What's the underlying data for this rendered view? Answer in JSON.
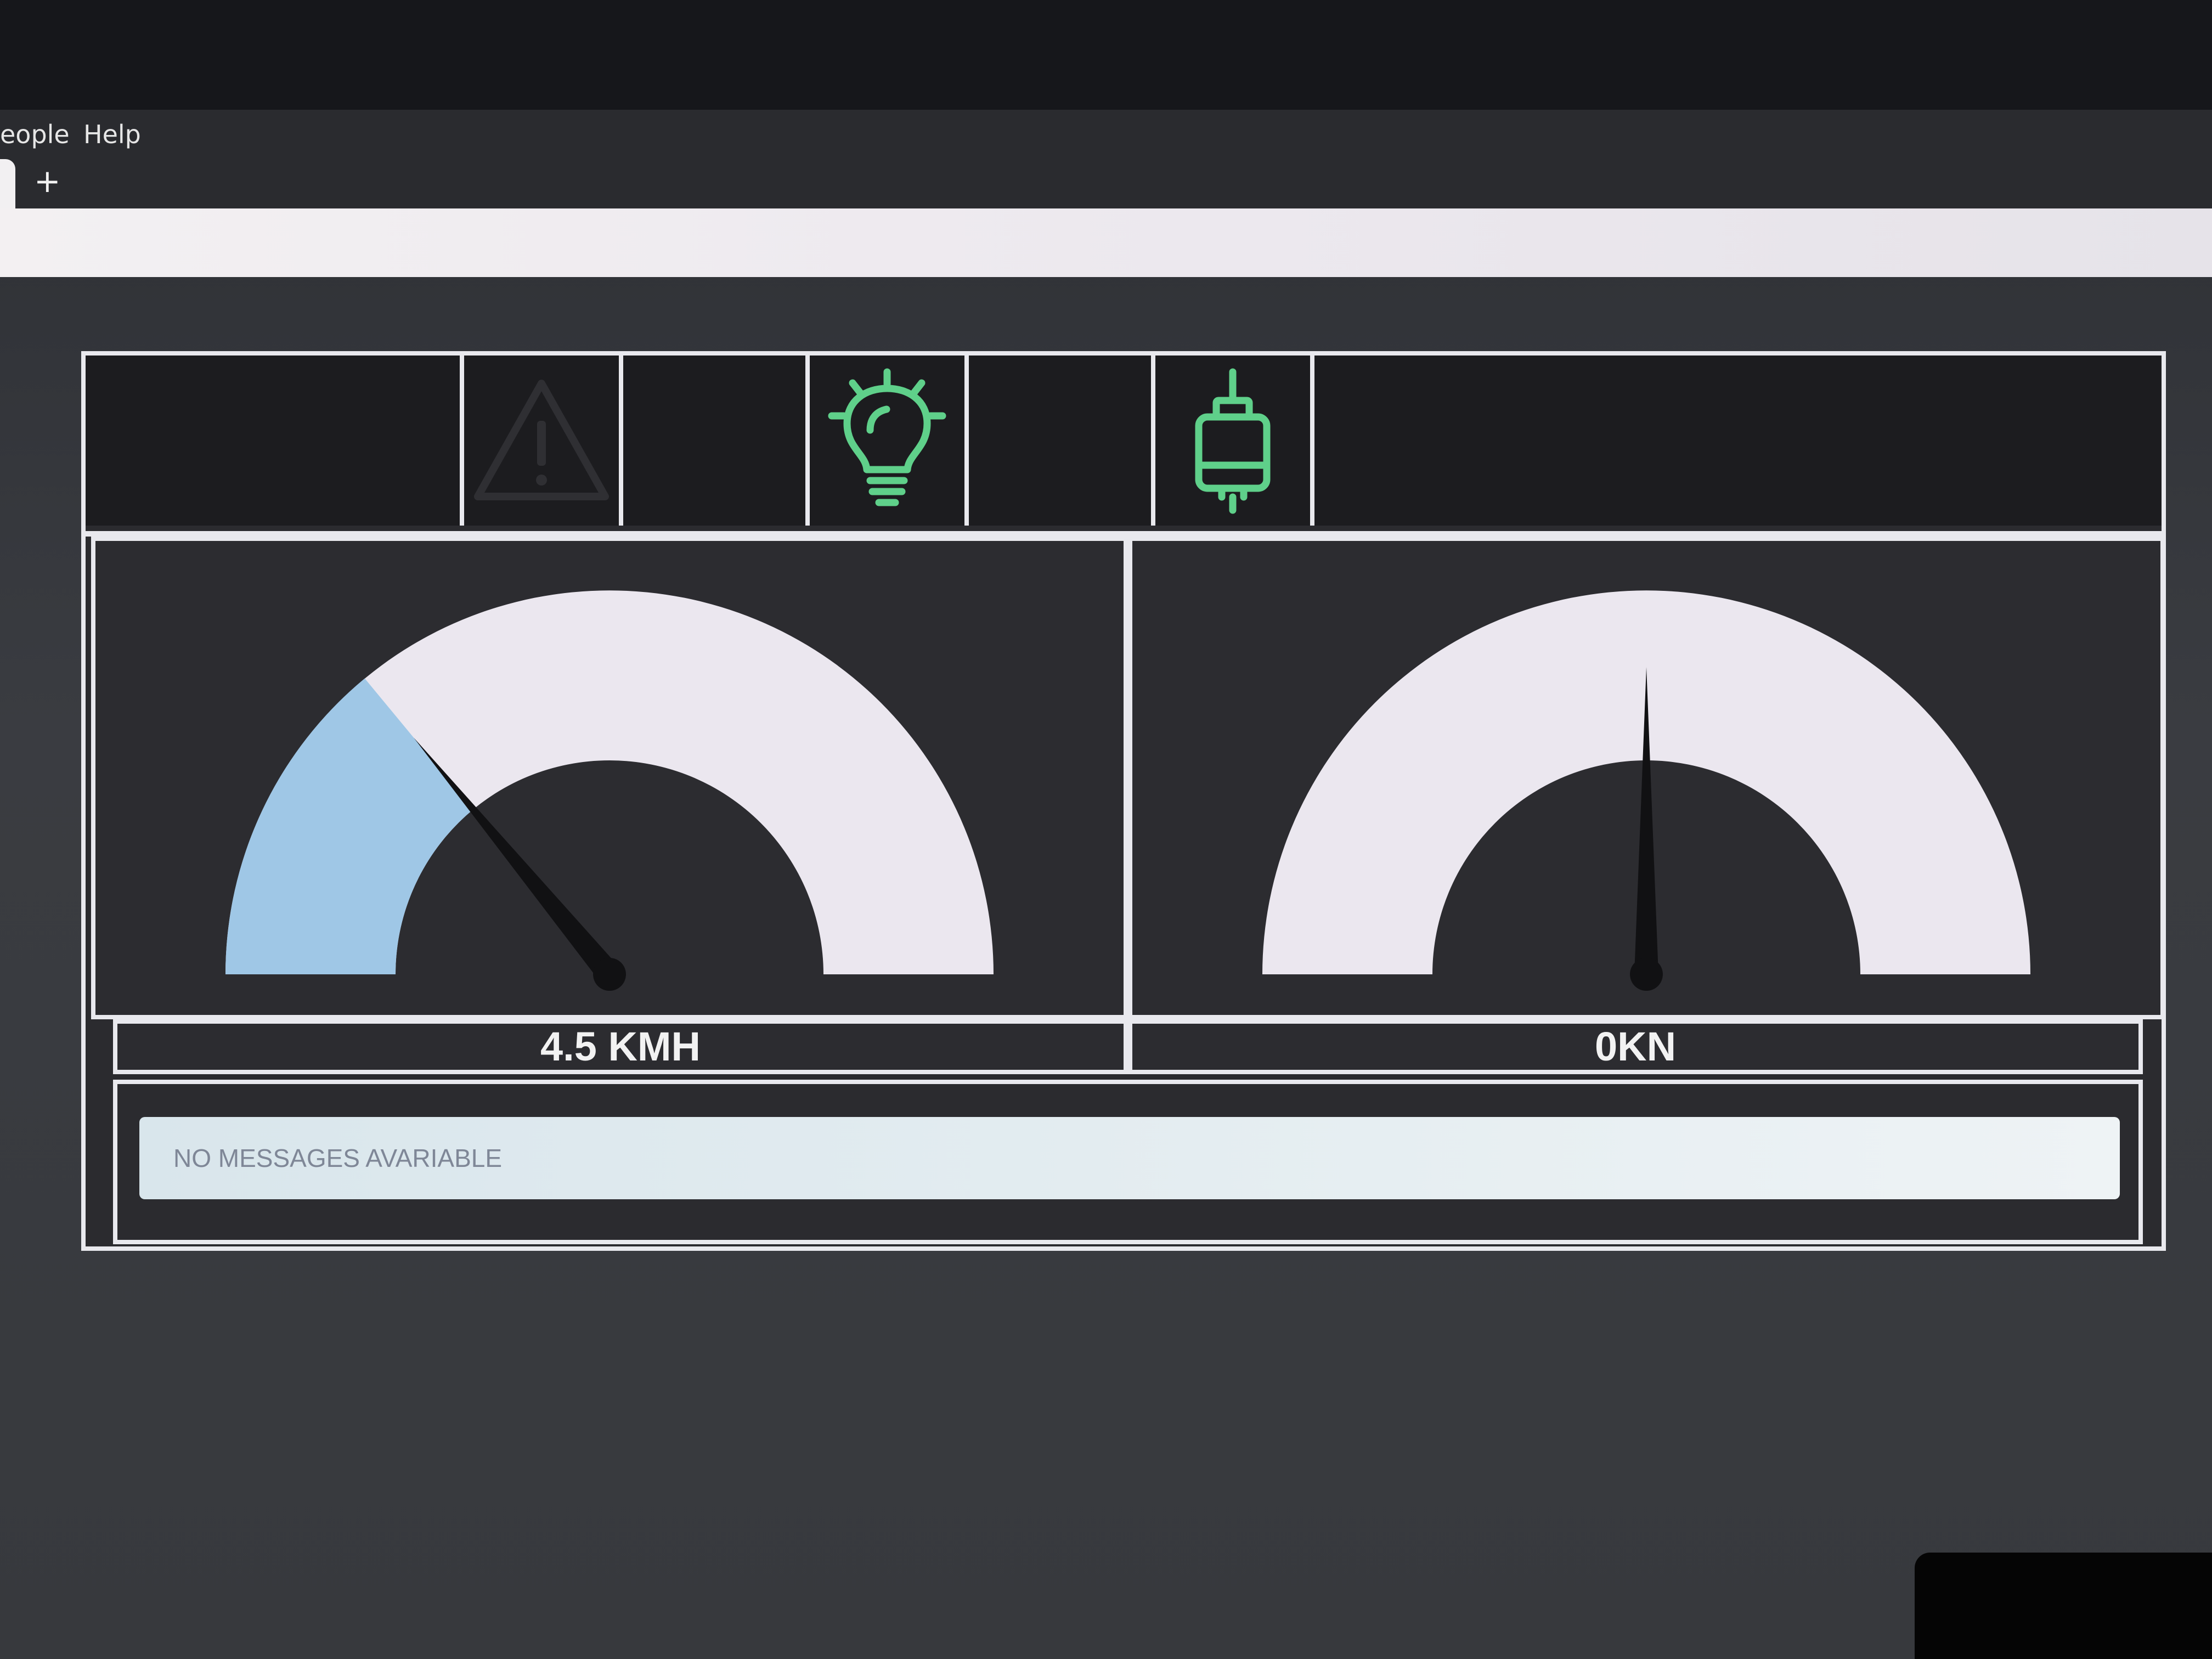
{
  "menu": {
    "items": [
      "eople",
      "Help"
    ]
  },
  "tabs": {
    "new_tab_label": "+"
  },
  "indicators": [
    {
      "name": "warning",
      "active": false,
      "color": "#2f2f33"
    },
    {
      "name": "lightbulb",
      "active": true,
      "color": "#5fd08a"
    },
    {
      "name": "plug",
      "active": true,
      "color": "#5fd08a"
    }
  ],
  "gauges": {
    "speed": {
      "readout": "4.5 KMH",
      "fraction": 0.28,
      "fill_color": "#9fc7e6",
      "track_color": "#ebe7ef"
    },
    "force": {
      "readout": "0KN",
      "fraction": 0.5,
      "track_color": "#ebe7ef"
    }
  },
  "messages": {
    "text": "NO MESSAGES AVARIABLE"
  }
}
